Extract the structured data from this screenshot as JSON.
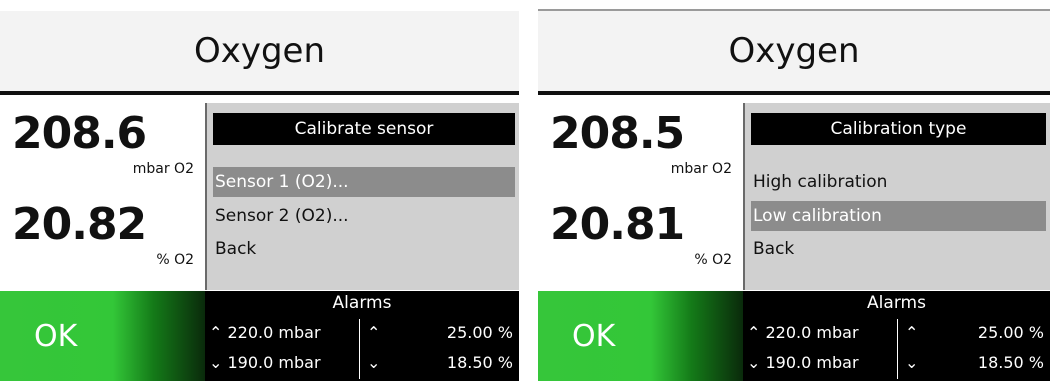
{
  "left": {
    "title": "Oxygen",
    "reading1": {
      "value": "208.6",
      "unit": "mbar O2"
    },
    "reading2": {
      "value": "20.82",
      "unit": "% O2"
    },
    "dialog": {
      "title": "Calibrate sensor",
      "items": [
        "Sensor 1 (O2)...",
        "Sensor 2 (O2)...",
        "Back"
      ],
      "selected_index": 0
    },
    "ok_label": "OK",
    "alarms": {
      "title": "Alarms",
      "high": {
        "symbol": "⌃",
        "mbar": "220.0 mbar",
        "percent": "25.00 %"
      },
      "low": {
        "symbol": "⌄",
        "mbar": "190.0 mbar",
        "percent": "18.50 %"
      }
    }
  },
  "right": {
    "title": "Oxygen",
    "reading1": {
      "value": "208.5",
      "unit": "mbar O2"
    },
    "reading2": {
      "value": "20.81",
      "unit": "% O2"
    },
    "dialog": {
      "title": "Calibration type",
      "items": [
        "High calibration",
        "Low calibration",
        "Back"
      ],
      "selected_index": 1
    },
    "ok_label": "OK",
    "alarms": {
      "title": "Alarms",
      "high": {
        "symbol": "⌃",
        "mbar": "220.0 mbar",
        "percent": "25.00 %"
      },
      "low": {
        "symbol": "⌄",
        "mbar": "190.0 mbar",
        "percent": "18.50 %"
      }
    }
  }
}
